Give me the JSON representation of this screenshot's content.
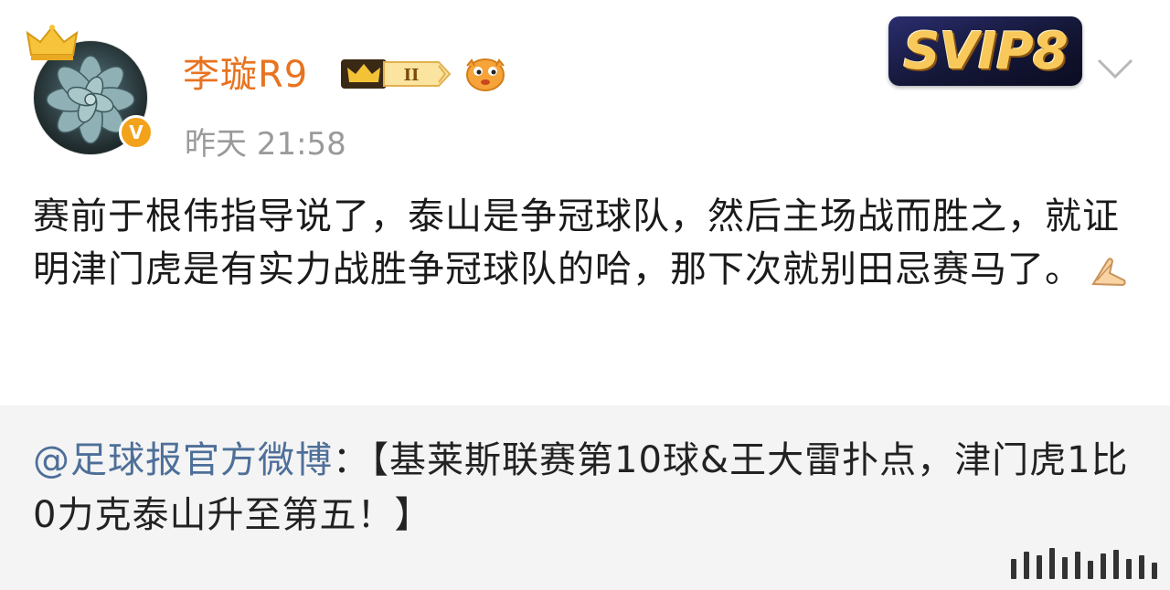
{
  "user": {
    "name": "李璇R9",
    "vip_level": "II",
    "timestamp": "昨天 21:58"
  },
  "svip_badge": "SVIP8",
  "post": {
    "body": "赛前于根伟指导说了，泰山是争冠球队，然后主场战而胜之，就证明津门虎是有实力战胜争冠球队的哈，那下次就别田忌赛马了。"
  },
  "repost": {
    "mention": "@足球报官方微博",
    "separator": "：",
    "text": "【基莱斯联赛第10球&王大雷扑点，津门虎1比0力克泰山升至第五！】"
  },
  "icons": {
    "crown": "crown-icon",
    "verified": "verified-icon",
    "vip": "vip-badge-icon",
    "face": "fish-face-emoji",
    "pray": "pray-hands-emoji",
    "chevron": "chevron-down-icon"
  },
  "colors": {
    "username": "#e8731f",
    "mention": "#4e6f99",
    "timestamp": "#9a9a9a",
    "repost_bg": "#f4f4f4"
  }
}
